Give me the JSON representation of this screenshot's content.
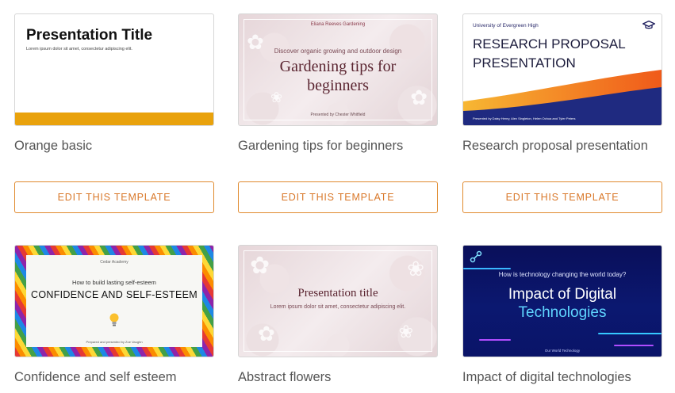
{
  "button_label": "EDIT THIS TEMPLATE",
  "accent_color": "#e08a2e",
  "templates": [
    {
      "name": "Orange basic",
      "thumb": {
        "title": "Presentation Title",
        "subtitle": "Lorem ipsum dolor sit amet, consectetur adipiscing elit."
      }
    },
    {
      "name": "Gardening tips for beginners",
      "thumb": {
        "brand": "Eliana Reeves Gardening",
        "tagline": "Discover organic growing and outdoor design",
        "title_line1": "Gardening tips for",
        "title_line2": "beginners",
        "presenter": "Presented by Chester Whitfield"
      }
    },
    {
      "name": "Research proposal presentation",
      "thumb": {
        "university": "University of Evergreen High",
        "title_line1": "RESEARCH PROPOSAL",
        "title_line2": "PRESENTATION",
        "presenter": "Presented by Daisy Henry, Alex Singleton, Helen Ochoa and Tyler Peters"
      }
    },
    {
      "name": "Confidence and self esteem",
      "thumb": {
        "academy": "Cedar Academy",
        "tagline": "How to build lasting self-esteem",
        "title": "CONFIDENCE AND SELF-ESTEEM",
        "presenter": "Prepared and presented by Zoe Vaughn"
      }
    },
    {
      "name": "Abstract flowers",
      "thumb": {
        "title": "Presentation title",
        "subtitle": "Lorem ipsum dolor sit amet, consectetur adipiscing elit."
      }
    },
    {
      "name": "Impact of digital technologies",
      "thumb": {
        "question": "How is technology changing the world today?",
        "title_line1": "Impact of Digital",
        "title_line2": "Technologies",
        "footer": "Our World Technology"
      }
    }
  ]
}
